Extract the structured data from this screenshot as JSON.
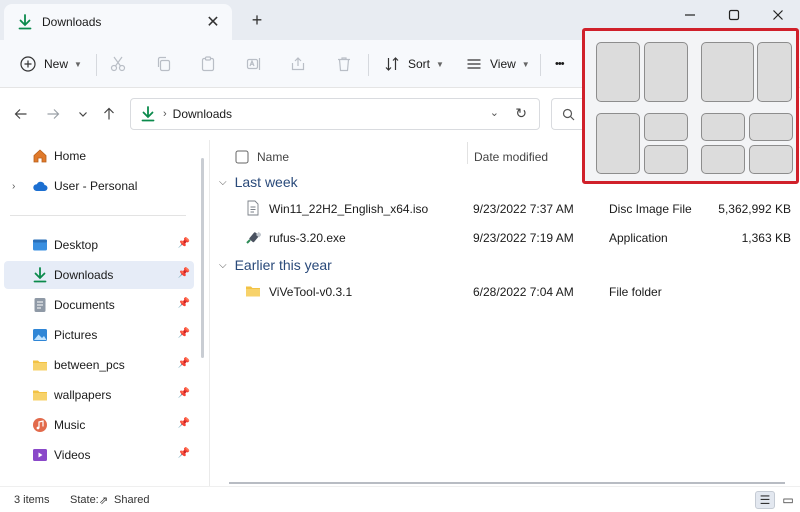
{
  "window": {
    "tab_title": "Downloads",
    "tab_close_icon": "close-icon",
    "new_tab_icon": "plus-icon"
  },
  "toolbar": {
    "new_label": "New",
    "sort_label": "Sort",
    "view_label": "View",
    "more_label": "•••"
  },
  "address": {
    "path": "Downloads",
    "search_placeholder": ""
  },
  "sidebar": {
    "items": [
      {
        "label": "Home",
        "icon": "home-icon"
      },
      {
        "label": "User - Personal",
        "icon": "cloud-icon"
      },
      {
        "label": "Desktop",
        "icon": "desktop-icon"
      },
      {
        "label": "Downloads",
        "icon": "download-icon"
      },
      {
        "label": "Documents",
        "icon": "document-icon"
      },
      {
        "label": "Pictures",
        "icon": "pictures-icon"
      },
      {
        "label": "between_pcs",
        "icon": "folder-icon"
      },
      {
        "label": "wallpapers",
        "icon": "folder-icon"
      },
      {
        "label": "Music",
        "icon": "music-icon"
      },
      {
        "label": "Videos",
        "icon": "videos-icon"
      }
    ]
  },
  "columns": {
    "name": "Name",
    "date_modified": "Date modified"
  },
  "groups": [
    {
      "title": "Last week",
      "files": [
        {
          "name": "Win11_22H2_English_x64.iso",
          "date": "9/23/2022 7:37 AM",
          "type": "Disc Image File",
          "size": "5,362,992 KB"
        },
        {
          "name": "rufus-3.20.exe",
          "date": "9/23/2022 7:19 AM",
          "type": "Application",
          "size": "1,363 KB"
        }
      ]
    },
    {
      "title": "Earlier this year",
      "files": [
        {
          "name": "ViVeTool-v0.3.1",
          "date": "6/28/2022 7:04 AM",
          "type": "File folder",
          "size": ""
        }
      ]
    }
  ],
  "status": {
    "item_count": "3 items",
    "state_label": "State:",
    "state_value": "Shared"
  },
  "colors": {
    "accent": "#0b8a4c",
    "snap_highlight": "#d0202a",
    "selection": "#e6ecf7"
  }
}
